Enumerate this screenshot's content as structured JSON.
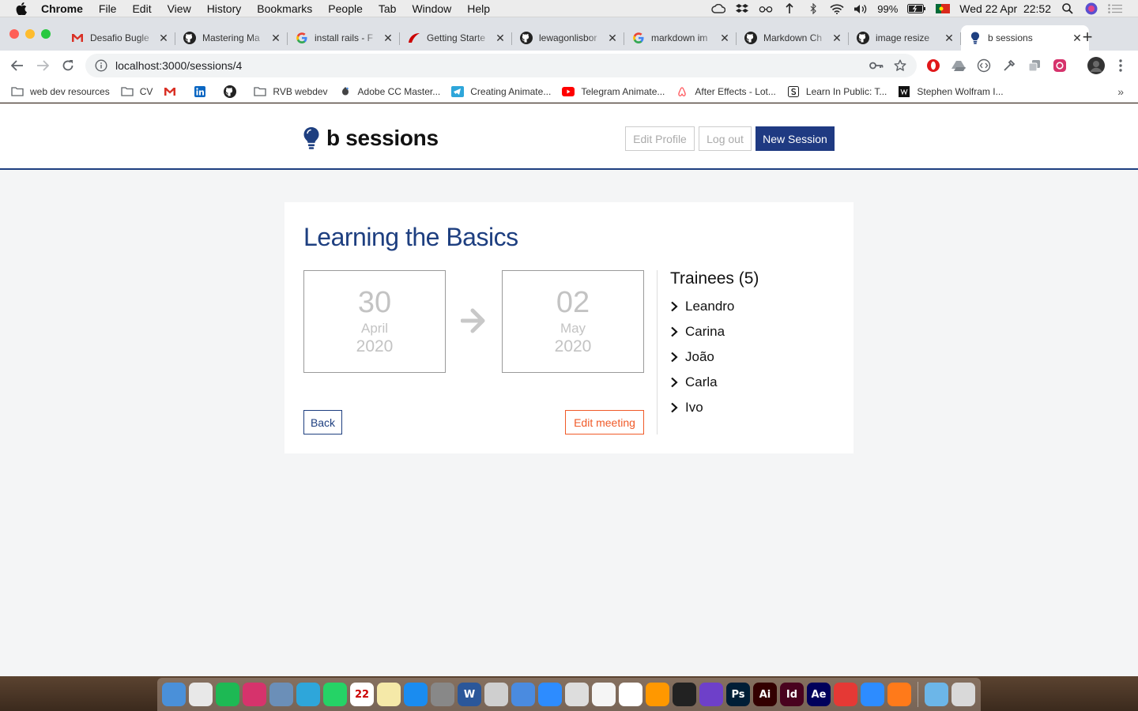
{
  "menubar": {
    "app": "Chrome",
    "items": [
      "File",
      "Edit",
      "View",
      "History",
      "Bookmarks",
      "People",
      "Tab",
      "Window",
      "Help"
    ],
    "battery": "99%",
    "clock": "Wed 22 Apr  22:52"
  },
  "tabs": [
    {
      "title": "Desafio Bugle",
      "icon": "gmail-icon"
    },
    {
      "title": "Mastering Ma",
      "icon": "github-icon"
    },
    {
      "title": "install rails - F",
      "icon": "google-icon"
    },
    {
      "title": "Getting Starte",
      "icon": "rails-icon"
    },
    {
      "title": "lewagonlisbor",
      "icon": "github-icon"
    },
    {
      "title": "markdown im",
      "icon": "google-icon"
    },
    {
      "title": "Markdown Ch",
      "icon": "github-icon"
    },
    {
      "title": "image resize",
      "icon": "github-icon"
    },
    {
      "title": "b sessions",
      "icon": "bulb-icon",
      "active": true
    }
  ],
  "toolbar": {
    "url": "localhost:3000/sessions/4"
  },
  "bookmarks": [
    {
      "label": "web dev resources",
      "icon": "folder-icon"
    },
    {
      "label": "CV",
      "icon": "folder-icon"
    },
    {
      "label": "",
      "icon": "gmail-icon"
    },
    {
      "label": "",
      "icon": "linkedin-icon"
    },
    {
      "label": "",
      "icon": "github-icon"
    },
    {
      "label": "RVB webdev",
      "icon": "folder-icon"
    },
    {
      "label": "Adobe CC Master...",
      "icon": "adobe-icon"
    },
    {
      "label": "Creating Animate...",
      "icon": "telegram-icon"
    },
    {
      "label": "Telegram Animate...",
      "icon": "youtube-icon"
    },
    {
      "label": "After Effects - Lot...",
      "icon": "airbnb-icon"
    },
    {
      "label": "Learn In Public: T...",
      "icon": "s-icon"
    },
    {
      "label": "Stephen Wolfram I...",
      "icon": "wolfram-icon"
    }
  ],
  "header": {
    "brand": "b sessions",
    "edit_profile": "Edit Profile",
    "log_out": "Log out",
    "new_session": "New Session"
  },
  "session": {
    "title": "Learning the Basics",
    "start": {
      "day": "30",
      "month": "April",
      "year": "2020"
    },
    "end": {
      "day": "02",
      "month": "May",
      "year": "2020"
    },
    "back": "Back",
    "edit": "Edit meeting",
    "trainees_title": "Trainees (5)",
    "trainees": [
      "Leandro",
      "Carina",
      "João",
      "Carla",
      "Ivo"
    ]
  },
  "colors": {
    "brand_blue": "#1e3f80",
    "edit_orange": "#f05a28",
    "page_bg": "#f4f5f6"
  },
  "dock": [
    {
      "name": "finder-icon",
      "color": "#4a90d9",
      "glyph": ""
    },
    {
      "name": "chrome-icon",
      "color": "#e8e8e8",
      "glyph": ""
    },
    {
      "name": "spotify-icon",
      "color": "#1db954",
      "glyph": ""
    },
    {
      "name": "instagram-icon",
      "color": "#d6336c",
      "glyph": ""
    },
    {
      "name": "screenshot-icon",
      "color": "#6b8fb8",
      "glyph": ""
    },
    {
      "name": "telegram-icon",
      "color": "#2ea6da",
      "glyph": ""
    },
    {
      "name": "whatsapp-icon",
      "color": "#25d366",
      "glyph": ""
    },
    {
      "name": "calendar-icon",
      "color": "#ffffff",
      "glyph": "22"
    },
    {
      "name": "notes-icon",
      "color": "#f5e9a8",
      "glyph": ""
    },
    {
      "name": "app-store-icon",
      "color": "#1a8cf0",
      "glyph": ""
    },
    {
      "name": "system-preferences-icon",
      "color": "#888888",
      "glyph": ""
    },
    {
      "name": "word-icon",
      "color": "#2b579a",
      "glyph": "W"
    },
    {
      "name": "script-editor-icon",
      "color": "#cfcfcf",
      "glyph": ""
    },
    {
      "name": "quicktime-icon",
      "color": "#4a8be0",
      "glyph": ""
    },
    {
      "name": "zoom-video-icon",
      "color": "#2d8cff",
      "glyph": ""
    },
    {
      "name": "network-radar-icon",
      "color": "#dddddd",
      "glyph": ""
    },
    {
      "name": "textedit-icon",
      "color": "#f5f5f5",
      "glyph": ""
    },
    {
      "name": "slack-icon",
      "color": "#ffffff",
      "glyph": ""
    },
    {
      "name": "sublime-icon",
      "color": "#ff9800",
      "glyph": ""
    },
    {
      "name": "terminal-icon",
      "color": "#222222",
      "glyph": ""
    },
    {
      "name": "github-desktop-icon",
      "color": "#6e40c9",
      "glyph": ""
    },
    {
      "name": "photoshop-icon",
      "color": "#001e36",
      "glyph": "Ps"
    },
    {
      "name": "illustrator-icon",
      "color": "#330000",
      "glyph": "Ai"
    },
    {
      "name": "indesign-icon",
      "color": "#49021f",
      "glyph": "Id"
    },
    {
      "name": "after-effects-icon",
      "color": "#00005b",
      "glyph": "Ae"
    },
    {
      "name": "hand-app-icon",
      "color": "#e53935",
      "glyph": ""
    },
    {
      "name": "zoom-icon",
      "color": "#2d8cff",
      "glyph": ""
    },
    {
      "name": "transmit-icon",
      "color": "#ff7a1a",
      "glyph": ""
    },
    {
      "name": "downloads-folder-icon",
      "color": "#6cb6e8",
      "glyph": ""
    },
    {
      "name": "trash-icon",
      "color": "#d9d9d9",
      "glyph": ""
    }
  ]
}
